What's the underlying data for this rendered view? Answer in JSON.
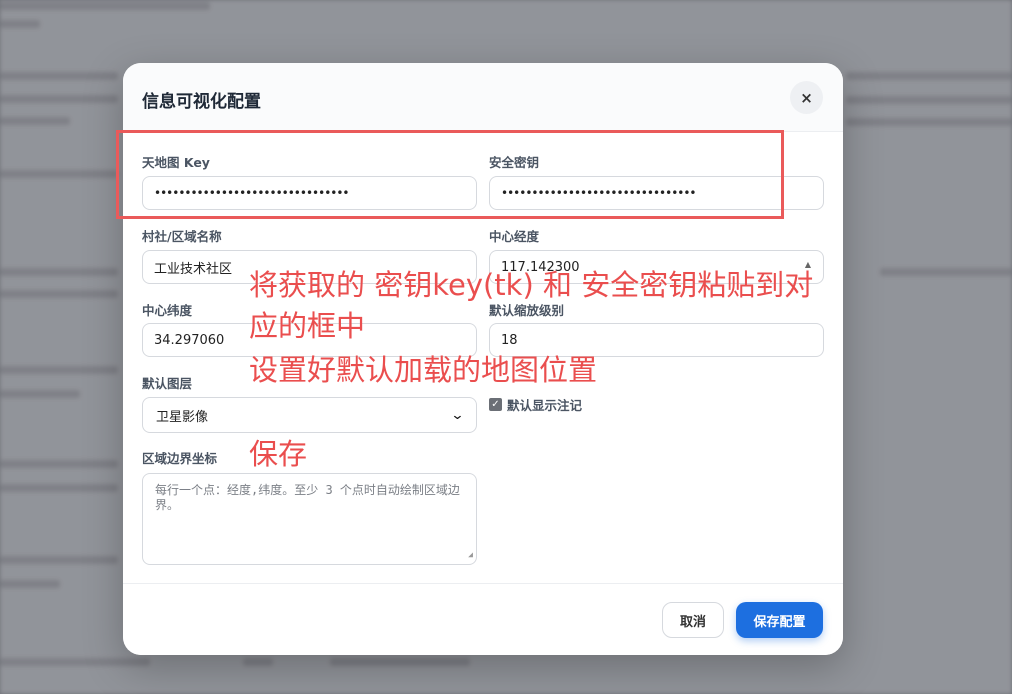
{
  "dialog": {
    "title": "信息可视化配置",
    "close_label": "×"
  },
  "fields": {
    "tianditu_key": {
      "label": "天地图 Key",
      "value": "••••••••••••••••••••••••••••••••"
    },
    "security_key": {
      "label": "安全密钥",
      "value": "••••••••••••••••••••••••••••••••"
    },
    "region_name": {
      "label": "村社/区域名称",
      "value": "工业技术社区"
    },
    "center_lng": {
      "label": "中心经度",
      "value": "117.142300"
    },
    "center_lat": {
      "label": "中心纬度",
      "value": "34.297060"
    },
    "zoom_level": {
      "label": "默认缩放级别",
      "value": "18"
    },
    "default_layer": {
      "label": "默认图层",
      "value": "卫星影像"
    },
    "show_labels": {
      "label": "默认显示注记",
      "checked": true
    },
    "boundary": {
      "label": "区域边界坐标",
      "placeholder": "每行一个点：经度,纬度。至少 3 个点时自动绘制区域边界。"
    }
  },
  "footer": {
    "cancel_label": "取消",
    "save_label": "保存配置"
  },
  "annotations": {
    "instruction_1": "将获取的 密钥key(tk) 和 安全密钥粘贴到对",
    "instruction_2": "应的框中",
    "instruction_3": "设置好默认加载的地图位置",
    "instruction_4": "保存"
  },
  "colors": {
    "primary": "#1d6fe0",
    "annotation": "#ea4e4e"
  }
}
